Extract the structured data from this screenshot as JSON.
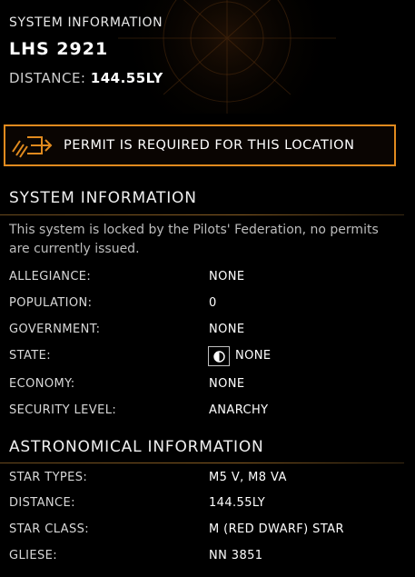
{
  "header": {
    "label": "SYSTEM INFORMATION",
    "system_name": "LHS 2921",
    "distance_label": "DISTANCE:",
    "distance_value": "144.55LY"
  },
  "permit": {
    "text": "PERMIT IS REQUIRED FOR THIS LOCATION",
    "icon": "permit-arrow-icon",
    "accent": "#e08a1e"
  },
  "system_info": {
    "title": "SYSTEM INFORMATION",
    "description": "This system is locked by the Pilots' Federation, no permits are currently issued.",
    "rows": [
      {
        "label": "ALLEGIANCE:",
        "value": "NONE"
      },
      {
        "label": "POPULATION:",
        "value": "0"
      },
      {
        "label": "GOVERNMENT:",
        "value": "NONE"
      },
      {
        "label": "STATE:",
        "value": "NONE",
        "icon": "state-half-circle-icon"
      },
      {
        "label": "ECONOMY:",
        "value": "NONE"
      },
      {
        "label": "SECURITY LEVEL:",
        "value": "ANARCHY"
      }
    ]
  },
  "astronomical_info": {
    "title": "ASTRONOMICAL INFORMATION",
    "rows": [
      {
        "label": "STAR TYPES:",
        "value": "M5 V, M8 VA"
      },
      {
        "label": "DISTANCE:",
        "value": "144.55LY"
      },
      {
        "label": "STAR CLASS:",
        "value": "M (RED DWARF) STAR"
      },
      {
        "label": "GLIESE:",
        "value": "NN 3851"
      }
    ]
  }
}
